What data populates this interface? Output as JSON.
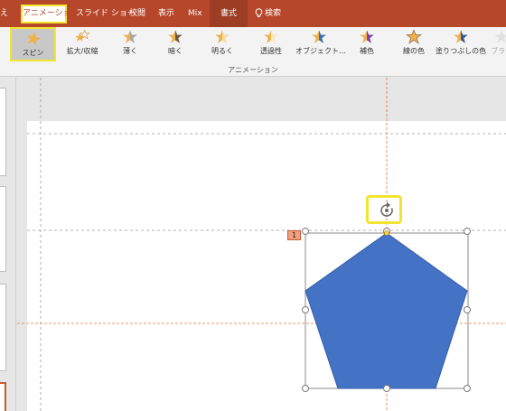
{
  "ribbon_tabs": [
    {
      "label": "え",
      "active": false
    },
    {
      "label": "アニメーション",
      "active": true,
      "highlighted": true
    },
    {
      "label": "スライド ショー",
      "active": false
    },
    {
      "label": "校閲",
      "active": false
    },
    {
      "label": "表示",
      "active": false
    },
    {
      "label": "Mix",
      "active": false
    },
    {
      "label": "書式",
      "active": false,
      "contextual": true
    },
    {
      "label": "検索",
      "icon": "lightbulb-icon",
      "active": false
    }
  ],
  "gallery": {
    "group_label": "アニメーション",
    "items": [
      {
        "label": "スピン",
        "icon": "spin-star-icon",
        "selected": true,
        "highlighted": true
      },
      {
        "label": "拡大/収縮",
        "icon": "grow-shrink-star-icon",
        "selected": false
      },
      {
        "label": "薄く",
        "icon": "desaturate-star-icon",
        "selected": false
      },
      {
        "label": "暗く",
        "icon": "darken-star-icon",
        "selected": false
      },
      {
        "label": "明るく",
        "icon": "lighten-star-icon",
        "selected": false
      },
      {
        "label": "透過性",
        "icon": "transparency-star-icon",
        "selected": false
      },
      {
        "label": "オブジェクト…",
        "icon": "object-color-star-icon",
        "selected": false
      },
      {
        "label": "補色",
        "icon": "complementary-color-star-icon",
        "selected": false
      },
      {
        "label": "線の色",
        "icon": "line-color-star-icon",
        "selected": false
      },
      {
        "label": "塗りつぶしの色",
        "icon": "fill-color-star-icon",
        "selected": false
      },
      {
        "label": "ブラシ",
        "icon": "brush-star-icon",
        "selected": false,
        "disabled": true
      }
    ]
  },
  "slide": {
    "animation_order_tag": "1",
    "shape": "pentagon",
    "shape_color": "#4472c4",
    "rotation_handle_highlighted": true
  },
  "colors": {
    "accent": "#b7472a",
    "highlight": "#f2e530",
    "guide": "#e8763a"
  }
}
